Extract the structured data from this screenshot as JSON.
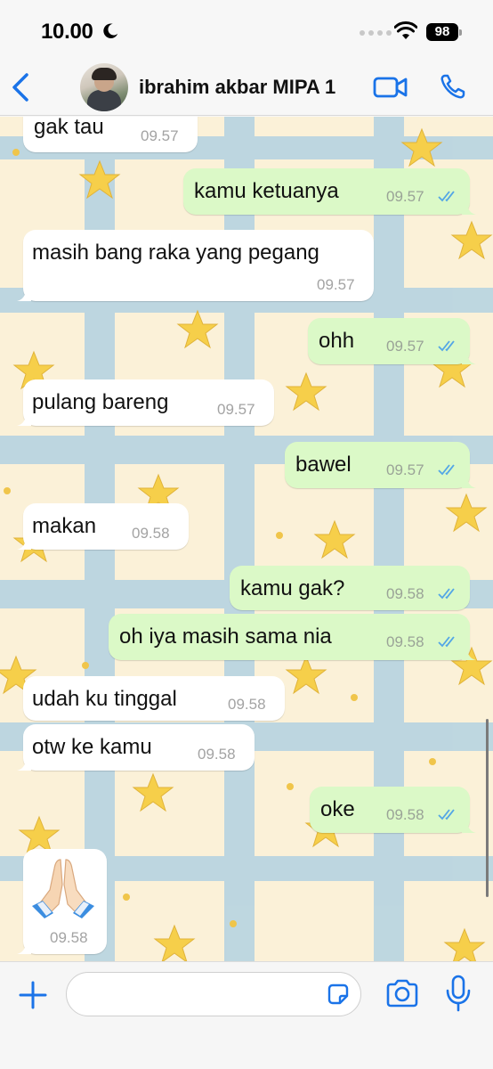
{
  "status_bar": {
    "time": "10.00",
    "battery": "98",
    "moon_icon": "moon-icon",
    "wifi_icon": "wifi-icon"
  },
  "header": {
    "contact_name": "ibrahim akbar MIPA 1",
    "back_icon": "chevron-left-icon",
    "video_icon": "video-camera-icon",
    "call_icon": "phone-icon",
    "accent_color": "#1a73e8"
  },
  "messages": [
    {
      "dir": "in",
      "text": "gak tau",
      "time": "09.57"
    },
    {
      "dir": "out",
      "text": "kamu ketuanya",
      "time": "09.57"
    },
    {
      "dir": "in",
      "text": "masih bang raka yang pegang",
      "time": "09.57"
    },
    {
      "dir": "out",
      "text": "ohh",
      "time": "09.57"
    },
    {
      "dir": "in",
      "text": "pulang bareng",
      "time": "09.57"
    },
    {
      "dir": "out",
      "text": "bawel",
      "time": "09.57"
    },
    {
      "dir": "in",
      "text": "makan",
      "time": "09.58"
    },
    {
      "dir": "out",
      "text": "kamu gak?",
      "time": "09.58"
    },
    {
      "dir": "out",
      "text": "oh iya masih sama nia",
      "time": "09.58"
    },
    {
      "dir": "in",
      "text": "udah ku tinggal",
      "time": "09.58"
    },
    {
      "dir": "in",
      "text": "otw ke kamu",
      "time": "09.58"
    },
    {
      "dir": "out",
      "text": "oke",
      "time": "09.58"
    },
    {
      "dir": "in",
      "emoji": "folded-hands-emoji",
      "time": "09.58"
    }
  ],
  "input_bar": {
    "placeholder": "",
    "plus_icon": "plus-icon",
    "sticker_icon": "sticker-icon",
    "camera_icon": "camera-icon",
    "mic_icon": "microphone-icon"
  },
  "colors": {
    "outgoing_bubble": "#dbf9c7",
    "incoming_bubble": "#ffffff",
    "read_ticks": "#53a6e6",
    "wallpaper_base": "#fbf1d8",
    "wallpaper_stripes": "#a9cde3",
    "wallpaper_stars": "#f6cf4a"
  }
}
